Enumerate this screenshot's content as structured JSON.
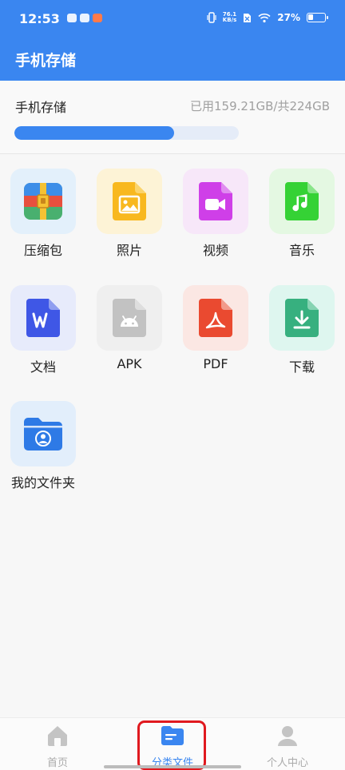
{
  "status": {
    "time": "12:53",
    "net_speed_top": "76.1",
    "net_speed_bottom": "KB/s",
    "battery": "27%"
  },
  "header": {
    "title": "手机存储"
  },
  "storage": {
    "label": "手机存储",
    "usage": "已用159.21GB/共224GB",
    "used_fraction": 0.71
  },
  "categories": [
    {
      "label": "压缩包",
      "icon": "archive-icon"
    },
    {
      "label": "照片",
      "icon": "photo-icon"
    },
    {
      "label": "视频",
      "icon": "video-icon"
    },
    {
      "label": "音乐",
      "icon": "music-icon"
    },
    {
      "label": "文档",
      "icon": "word-doc-icon"
    },
    {
      "label": "APK",
      "icon": "android-icon"
    },
    {
      "label": "PDF",
      "icon": "pdf-icon"
    },
    {
      "label": "下载",
      "icon": "download-icon"
    },
    {
      "label": "我的文件夹",
      "icon": "user-folder-icon"
    }
  ],
  "nav": [
    {
      "label": "首页",
      "icon": "home-icon"
    },
    {
      "label": "分类文件",
      "icon": "folder-icon",
      "active": true
    },
    {
      "label": "个人中心",
      "icon": "user-icon"
    }
  ],
  "colors": {
    "accent": "#3a86f0",
    "highlight": "#e0191f"
  }
}
